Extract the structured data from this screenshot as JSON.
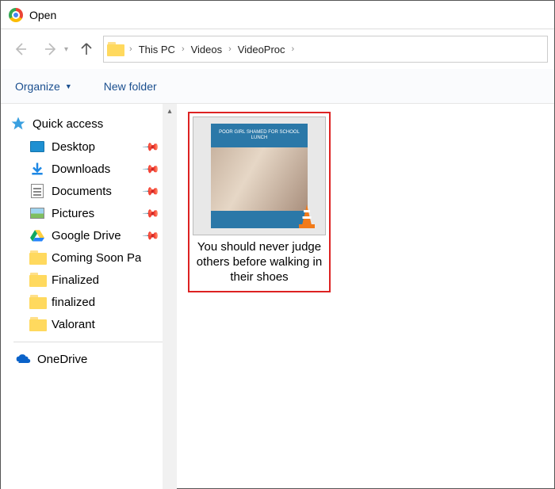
{
  "window": {
    "title": "Open"
  },
  "breadcrumb": {
    "items": [
      "This PC",
      "Videos",
      "VideoProc"
    ]
  },
  "toolbar": {
    "organize": "Organize",
    "new_folder": "New folder"
  },
  "sidebar": {
    "quick_access": "Quick access",
    "items": [
      {
        "label": "Desktop",
        "pinned": true,
        "icon": "desktop"
      },
      {
        "label": "Downloads",
        "pinned": true,
        "icon": "downloads"
      },
      {
        "label": "Documents",
        "pinned": true,
        "icon": "documents"
      },
      {
        "label": "Pictures",
        "pinned": true,
        "icon": "pictures"
      },
      {
        "label": "Google Drive",
        "pinned": true,
        "icon": "gdrive"
      },
      {
        "label": "Coming Soon Pa",
        "pinned": false,
        "icon": "folder"
      },
      {
        "label": "Finalized",
        "pinned": false,
        "icon": "folder"
      },
      {
        "label": "finalized",
        "pinned": false,
        "icon": "folder"
      },
      {
        "label": "Valorant",
        "pinned": false,
        "icon": "folder"
      }
    ],
    "onedrive": "OneDrive"
  },
  "content": {
    "file": {
      "name": "You should never judge others before walking in their shoes",
      "thumb_caption": "POOR GIRL SHAMED FOR SCHOOL LUNCH"
    }
  }
}
